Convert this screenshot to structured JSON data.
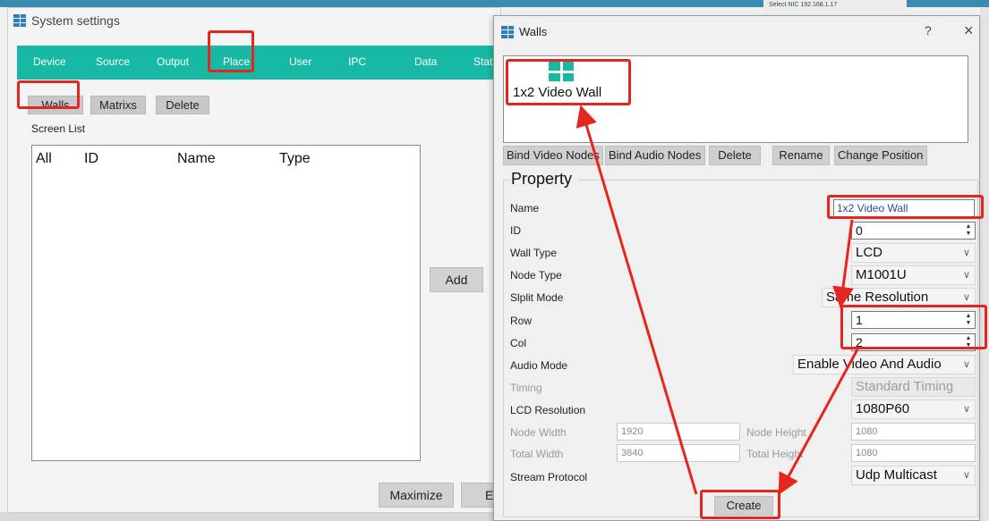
{
  "system_window": {
    "title": "System settings",
    "nav": [
      "Device",
      "Source",
      "Output",
      "Place",
      "User",
      "IPC",
      "Data",
      "Statu"
    ],
    "buttons": {
      "walls": "Walls",
      "matrixs": "Matrixs",
      "delete": "Delete"
    },
    "screen_list_label": "Screen List",
    "list_headers": [
      "All",
      "ID",
      "Name",
      "Type"
    ],
    "add_button": "Add",
    "maximize_button": "Maximize",
    "partial_button": "E"
  },
  "background_window": {
    "text": "Select NIC   192.168.1.17"
  },
  "walls_dialog": {
    "title": "Walls",
    "help": "?",
    "close": "×",
    "wall_item": "1x2 Video Wall",
    "buttons": {
      "bind_video": "Bind Video Nodes",
      "bind_audio": "Bind Audio Nodes",
      "delete": "Delete",
      "rename": "Rename",
      "change_position": "Change Position"
    },
    "property_title": "Property",
    "labels": {
      "name": "Name",
      "id": "ID",
      "wall_type": "Wall Type",
      "node_type": "Node Type",
      "split_mode": "Slplit Mode",
      "row": "Row",
      "col": "Col",
      "audio_mode": "Audio Mode",
      "timing": "Timing",
      "lcd_resolution": "LCD Resolution",
      "node_width": "Node Width",
      "node_height": "Node Height",
      "total_width": "Total Width",
      "total_height": "Total Height",
      "stream_protocol": "Stream Protocol"
    },
    "values": {
      "name": "1x2 Video Wall",
      "id": "0",
      "wall_type": "LCD",
      "node_type": "M1001U",
      "split_mode": "Same Resolution",
      "row": "1",
      "col": "2",
      "audio_mode": "Enable Video And Audio",
      "timing": "Standard Timing",
      "lcd_resolution": "1080P60",
      "node_width": "1920",
      "node_height": "1080",
      "total_width": "3840",
      "total_height": "1080",
      "stream_protocol": "Udp Multicast"
    },
    "create_button": "Create"
  },
  "colors": {
    "accent": "#18b9a4",
    "highlight": "#e5261f"
  }
}
